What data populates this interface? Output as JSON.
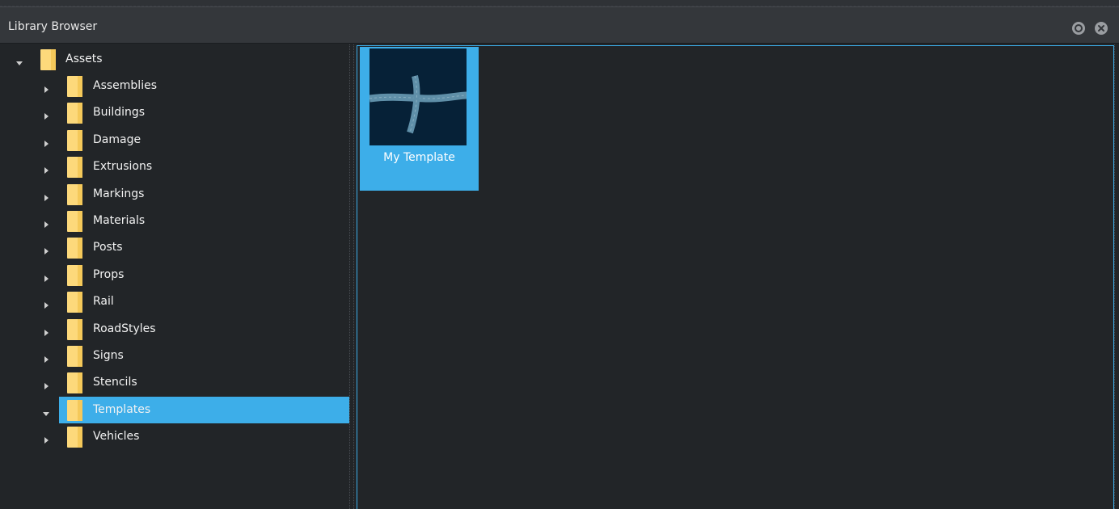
{
  "window": {
    "title": "Library Browser",
    "float_icon": "float-icon",
    "close_icon": "close-icon"
  },
  "tree": {
    "root": {
      "label": "Assets",
      "expanded": true
    },
    "items": [
      {
        "label": "Assemblies",
        "expanded": false,
        "selected": false
      },
      {
        "label": "Buildings",
        "expanded": false,
        "selected": false
      },
      {
        "label": "Damage",
        "expanded": false,
        "selected": false
      },
      {
        "label": "Extrusions",
        "expanded": false,
        "selected": false
      },
      {
        "label": "Markings",
        "expanded": false,
        "selected": false
      },
      {
        "label": "Materials",
        "expanded": false,
        "selected": false
      },
      {
        "label": "Posts",
        "expanded": false,
        "selected": false
      },
      {
        "label": "Props",
        "expanded": false,
        "selected": false
      },
      {
        "label": "Rail",
        "expanded": false,
        "selected": false
      },
      {
        "label": "RoadStyles",
        "expanded": false,
        "selected": false
      },
      {
        "label": "Signs",
        "expanded": false,
        "selected": false
      },
      {
        "label": "Stencils",
        "expanded": false,
        "selected": false
      },
      {
        "label": "Templates",
        "expanded": true,
        "selected": true
      },
      {
        "label": "Vehicles",
        "expanded": false,
        "selected": false
      }
    ]
  },
  "content": {
    "items": [
      {
        "label": "My Template",
        "thumbnail": "road-intersection-thumbnail",
        "selected": true
      }
    ]
  },
  "colors": {
    "accent": "#3daee9",
    "background": "#222528",
    "titlebar": "#34373b",
    "folder": "#fdd97b",
    "thumbnail_bg": "#062137"
  }
}
